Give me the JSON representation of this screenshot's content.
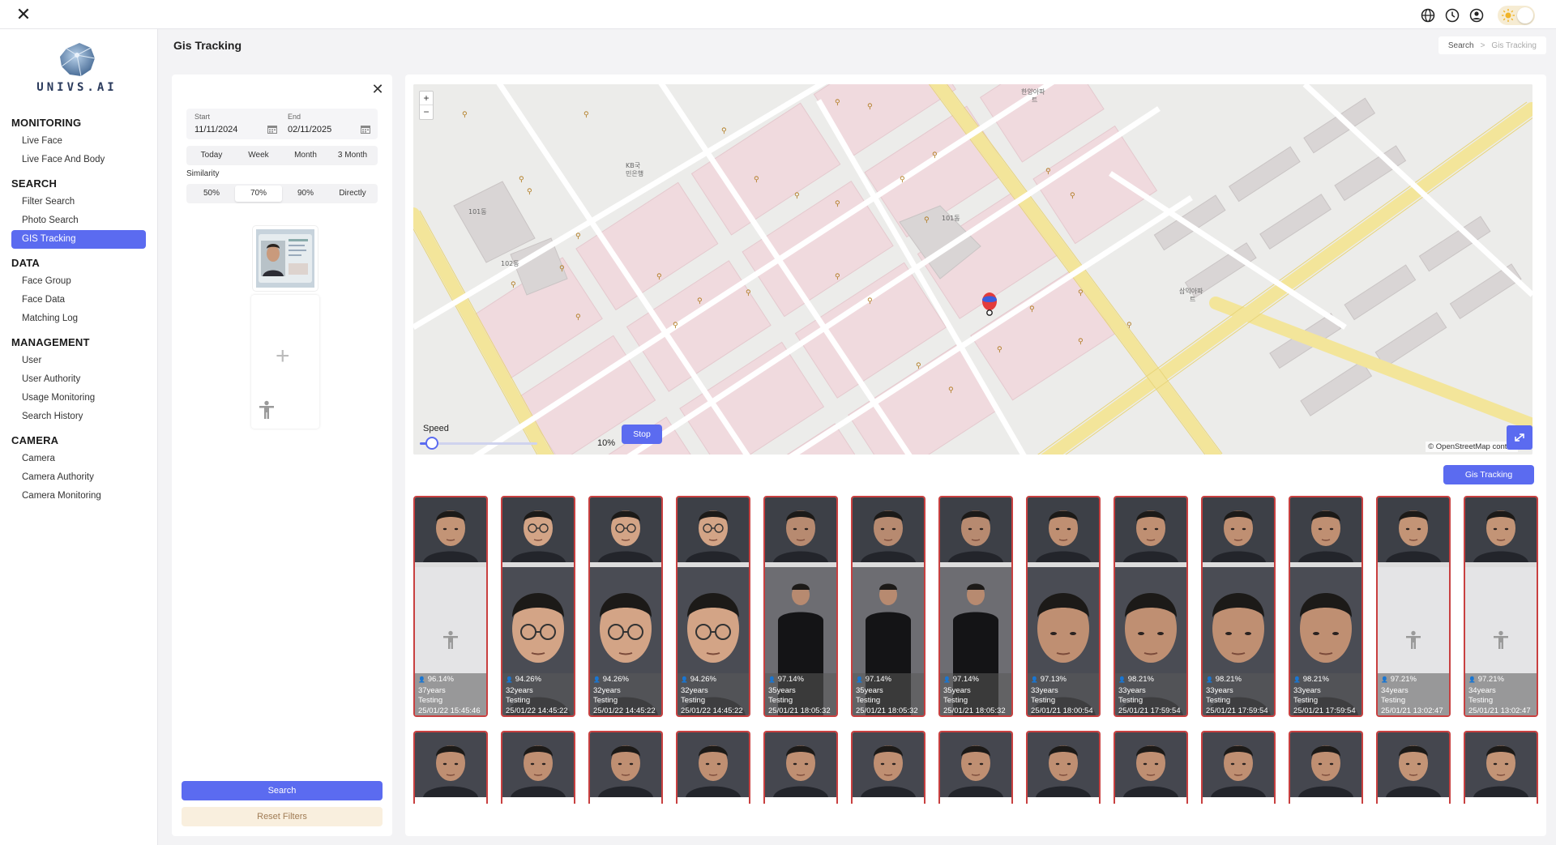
{
  "topbar": {
    "icons": [
      "close-icon",
      "globe-icon",
      "clock-icon",
      "user-circle-icon",
      "theme-toggle"
    ]
  },
  "logo": {
    "text": "UNIVS.AI"
  },
  "sidebar": {
    "sections": [
      {
        "title": "MONITORING",
        "items": [
          "Live Face",
          "Live Face And Body"
        ]
      },
      {
        "title": "SEARCH",
        "items": [
          "Filter Search",
          "Photo Search",
          "GIS Tracking"
        ]
      },
      {
        "title": "DATA",
        "items": [
          "Face Group",
          "Face Data",
          "Matching Log"
        ]
      },
      {
        "title": "MANAGEMENT",
        "items": [
          "User",
          "User Authority",
          "Usage Monitoring",
          "Search History"
        ]
      },
      {
        "title": "CAMERA",
        "items": [
          "Camera",
          "Camera Authority",
          "Camera Monitoring"
        ]
      }
    ],
    "active_item": "GIS Tracking"
  },
  "page": {
    "title": "Gis Tracking",
    "breadcrumb": [
      "Search",
      "Gis Tracking"
    ]
  },
  "filters": {
    "start_label": "Start",
    "start_value": "11/11/2024",
    "end_label": "End",
    "end_value": "02/11/2025",
    "ranges": [
      "Today",
      "Week",
      "Month",
      "3 Month"
    ],
    "similarity_label": "Similarity",
    "similarity_options": [
      "50%",
      "70%",
      "90%",
      "Directly"
    ],
    "similarity_selected": "70%",
    "search_label": "Search",
    "reset_label": "Reset Filters"
  },
  "map": {
    "zoom_in": "+",
    "zoom_out": "−",
    "speed_label": "Speed",
    "speed_value": "10%",
    "speed_fraction": 0.1,
    "stop_label": "Stop",
    "attribution": "© OpenStreetMap contrib",
    "labels": [
      "한양아파트",
      "삼익아파트",
      "101동",
      "102동",
      "한양아파트",
      "KB국민은행"
    ]
  },
  "gis_button": "Gis Tracking",
  "results": [
    {
      "similarity": "96.14%",
      "age": "37years",
      "group": "Testing",
      "time": "25/01/22 15:45:46",
      "body": false,
      "tone": "a"
    },
    {
      "similarity": "94.26%",
      "age": "32years",
      "group": "Testing",
      "time": "25/01/22 14:45:22",
      "body": true,
      "tone": "b"
    },
    {
      "similarity": "94.26%",
      "age": "32years",
      "group": "Testing",
      "time": "25/01/22 14:45:22",
      "body": true,
      "tone": "b"
    },
    {
      "similarity": "94.26%",
      "age": "32years",
      "group": "Testing",
      "time": "25/01/22 14:45:22",
      "body": true,
      "tone": "b"
    },
    {
      "similarity": "97.14%",
      "age": "35years",
      "group": "Testing",
      "time": "25/01/21 18:05:32",
      "body": true,
      "tone": "c"
    },
    {
      "similarity": "97.14%",
      "age": "35years",
      "group": "Testing",
      "time": "25/01/21 18:05:32",
      "body": true,
      "tone": "c"
    },
    {
      "similarity": "97.14%",
      "age": "35years",
      "group": "Testing",
      "time": "25/01/21 18:05:32",
      "body": true,
      "tone": "c"
    },
    {
      "similarity": "97.13%",
      "age": "33years",
      "group": "Testing",
      "time": "25/01/21 18:00:54",
      "body": true,
      "tone": "d"
    },
    {
      "similarity": "98.21%",
      "age": "33years",
      "group": "Testing",
      "time": "25/01/21 17:59:54",
      "body": true,
      "tone": "d"
    },
    {
      "similarity": "98.21%",
      "age": "33years",
      "group": "Testing",
      "time": "25/01/21 17:59:54",
      "body": true,
      "tone": "d"
    },
    {
      "similarity": "98.21%",
      "age": "33years",
      "group": "Testing",
      "time": "25/01/21 17:59:54",
      "body": true,
      "tone": "d"
    },
    {
      "similarity": "97.21%",
      "age": "34years",
      "group": "Testing",
      "time": "25/01/21 13:02:47",
      "body": false,
      "tone": "a"
    },
    {
      "similarity": "97.21%",
      "age": "34years",
      "group": "Testing",
      "time": "25/01/21 13:02:47",
      "body": false,
      "tone": "a"
    }
  ],
  "results_row2_count": 13
}
